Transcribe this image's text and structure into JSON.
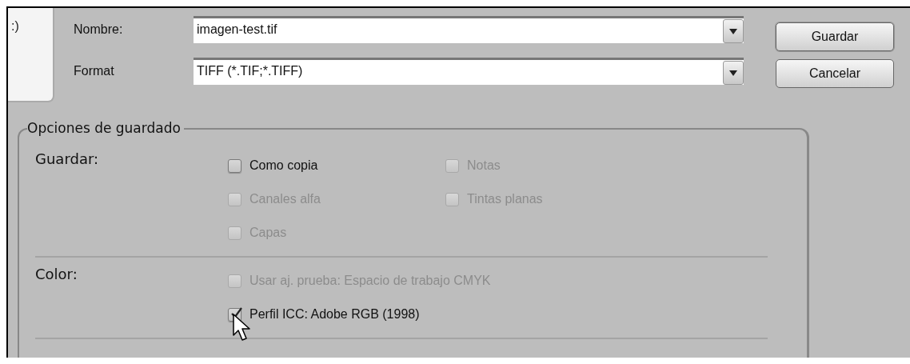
{
  "side_panel": {
    "text": ":)"
  },
  "fields": [
    {
      "label": "Nombre:",
      "value": "imagen-test.tif",
      "kind": "combo"
    },
    {
      "label": "Format",
      "value": "TIFF (*.TIF;*.TIFF)",
      "kind": "combo"
    }
  ],
  "buttons": [
    {
      "label": "Guardar",
      "default": true
    },
    {
      "label": "Cancelar",
      "default": false
    }
  ],
  "group": {
    "title": "Opciones de guardado",
    "sections": [
      {
        "label": "Guardar:",
        "columns": [
          [
            {
              "label": "Como copia",
              "checked": false,
              "disabled": false
            },
            {
              "label": "Canales alfa",
              "checked": false,
              "disabled": true
            },
            {
              "label": "Capas",
              "checked": false,
              "disabled": true
            }
          ],
          [
            {
              "label": "Notas",
              "checked": false,
              "disabled": true
            },
            {
              "label": "Tintas planas",
              "checked": false,
              "disabled": true
            }
          ]
        ]
      },
      {
        "label": "Color:",
        "columns": [
          [
            {
              "label": "Usar aj. prueba: Espacio de trabajo CMYK",
              "checked": false,
              "disabled": true
            },
            {
              "label": "Perfil ICC: Adobe RGB (1998)",
              "checked": true,
              "disabled": false,
              "cursor": true
            }
          ]
        ]
      }
    ]
  }
}
